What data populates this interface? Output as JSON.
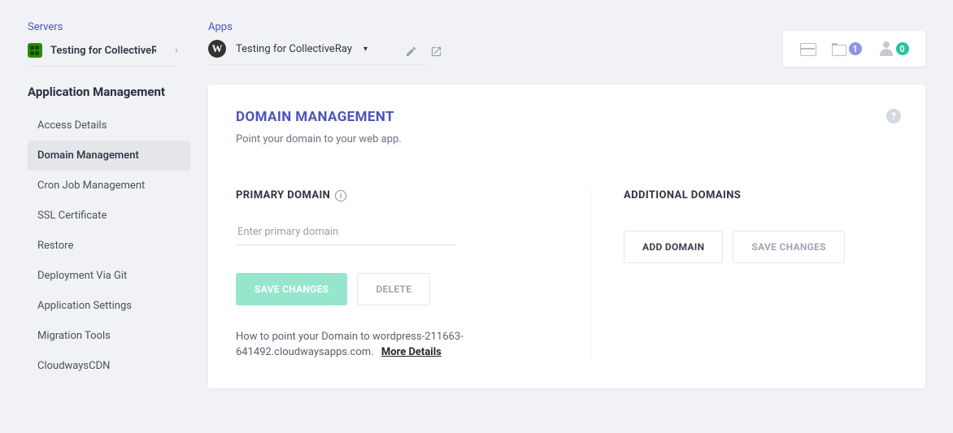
{
  "breadcrumb": {
    "servers_label": "Servers",
    "apps_label": "Apps",
    "server_name": "Testing for CollectiveR",
    "app_name": "Testing for CollectiveRay"
  },
  "top_right": {
    "projects_count": "1",
    "users_count": "0"
  },
  "sidebar": {
    "title": "Application Management",
    "items": [
      {
        "label": "Access Details"
      },
      {
        "label": "Domain Management"
      },
      {
        "label": "Cron Job Management"
      },
      {
        "label": "SSL Certificate"
      },
      {
        "label": "Restore"
      },
      {
        "label": "Deployment Via Git"
      },
      {
        "label": "Application Settings"
      },
      {
        "label": "Migration Tools"
      },
      {
        "label": "CloudwaysCDN"
      }
    ],
    "active_index": 1
  },
  "panel": {
    "title": "DOMAIN MANAGEMENT",
    "subtitle": "Point your domain to your web app.",
    "primary": {
      "label": "PRIMARY DOMAIN",
      "placeholder": "Enter primary domain",
      "value": "",
      "save_label": "SAVE CHANGES",
      "delete_label": "DELETE",
      "help_prefix": "How to point your Domain to",
      "help_domain": "wordpress-211663-641492.cloudwaysapps.com.",
      "more_details": "More Details"
    },
    "additional": {
      "label": "ADDITIONAL DOMAINS",
      "add_label": "ADD DOMAIN",
      "save_label": "SAVE CHANGES"
    }
  }
}
